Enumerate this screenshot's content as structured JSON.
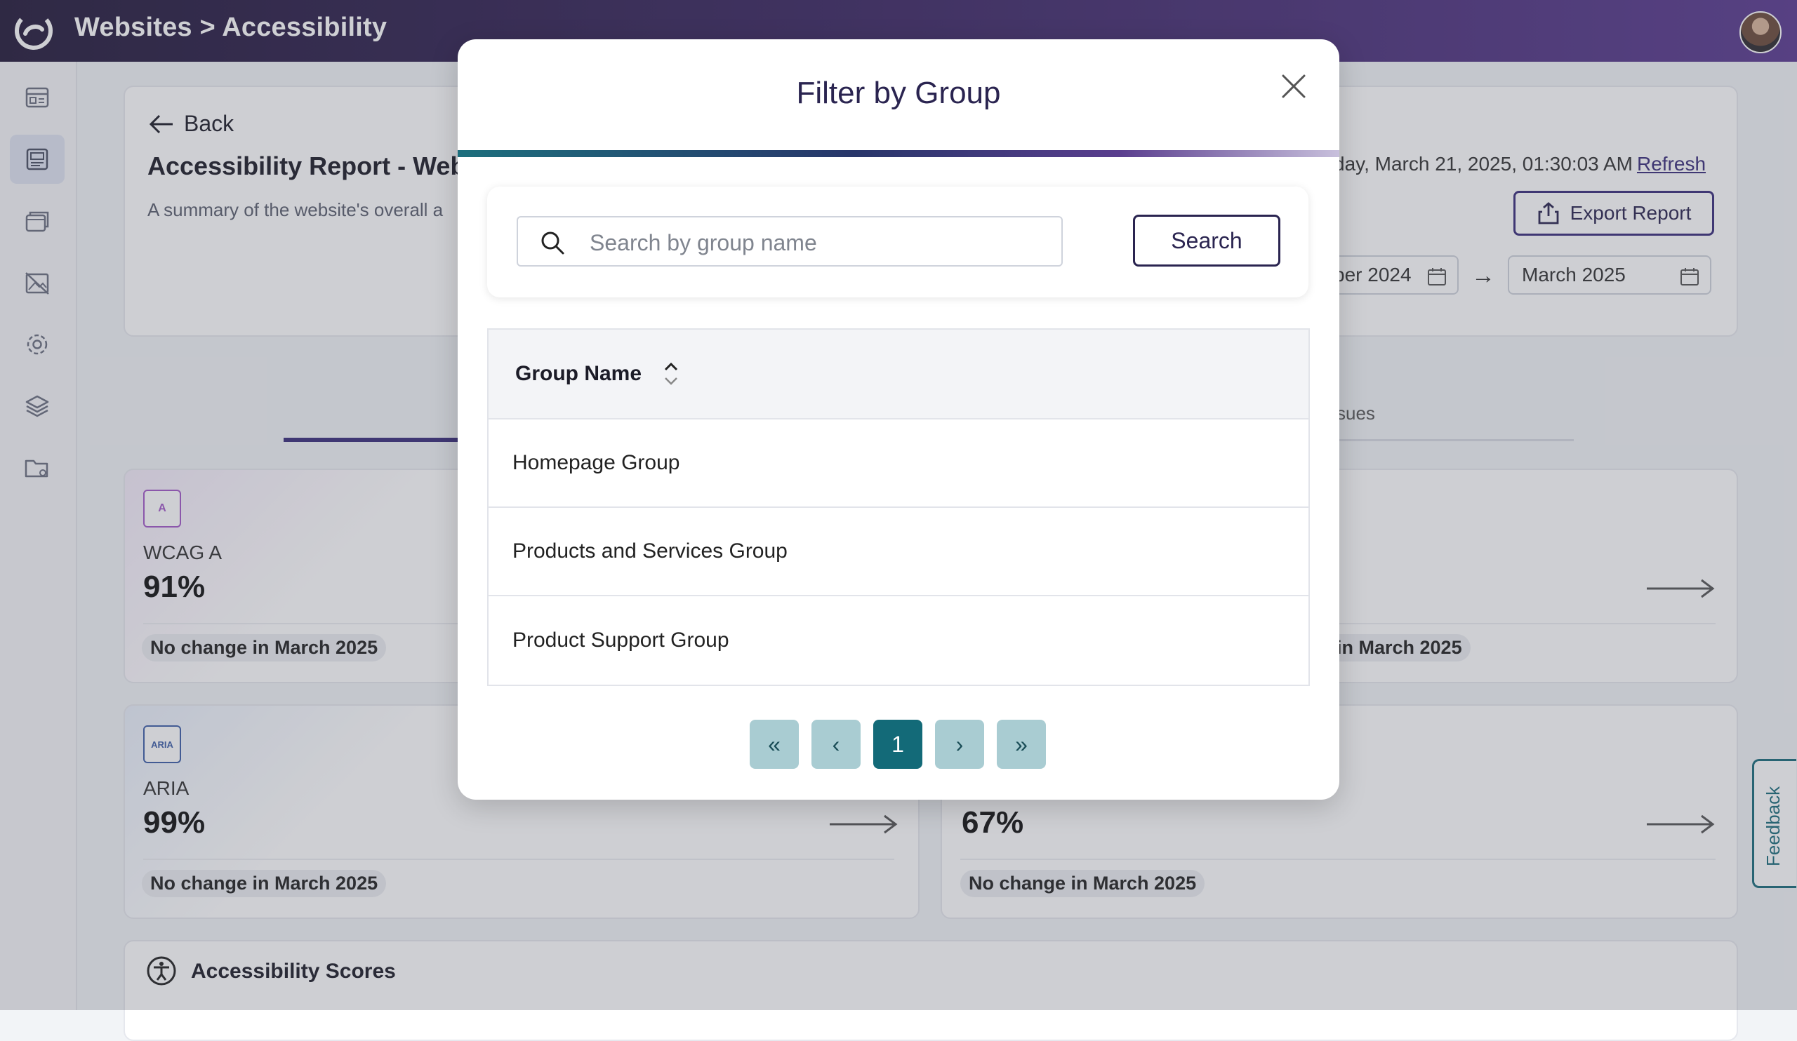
{
  "header": {
    "breadcrumb": "Websites > Accessibility"
  },
  "sidebar": {
    "items": [
      {
        "icon": "dashboard-icon"
      },
      {
        "icon": "report-icon",
        "active": true
      },
      {
        "icon": "pages-icon"
      },
      {
        "icon": "no-image-icon"
      },
      {
        "icon": "settings-icon"
      },
      {
        "icon": "layers-icon"
      },
      {
        "icon": "folder-settings-icon"
      }
    ]
  },
  "report": {
    "back_label": "Back",
    "title": "Accessibility Report - Webs",
    "subtitle": "A summary of the website's overall a",
    "updated_text": "day, March 21, 2025, 01:30:03 AM",
    "refresh_label": "Refresh",
    "export_label": "Export Report",
    "date_from": "ber 2024",
    "date_to": "March 2025",
    "tab_issues_label": "sues"
  },
  "metrics": [
    {
      "badge": "A",
      "name": "WCAG A",
      "value": "91%",
      "change": "No change in March 2025"
    },
    {
      "change": "in March 2025"
    },
    {
      "badge": "ARIA",
      "name": "ARIA",
      "value": "99%",
      "change": "No change in March 2025"
    },
    {
      "value": "67%",
      "change": "No change in March 2025"
    }
  ],
  "scores_title": "Accessibility Scores",
  "feedback_label": "Feedback",
  "modal": {
    "title": "Filter by Group",
    "search_placeholder": "Search by group name",
    "search_value": "",
    "search_button": "Search",
    "column_header": "Group Name",
    "groups": [
      "Homepage Group",
      "Products and Services Group",
      "Product Support Group"
    ],
    "pagination": {
      "first": "«",
      "prev": "‹",
      "current_page": "1",
      "next": "›",
      "last": "»"
    }
  },
  "colors": {
    "brand": "#3a2d7a",
    "teal": "#136a78",
    "pager_inactive": "#a9ccd2"
  }
}
